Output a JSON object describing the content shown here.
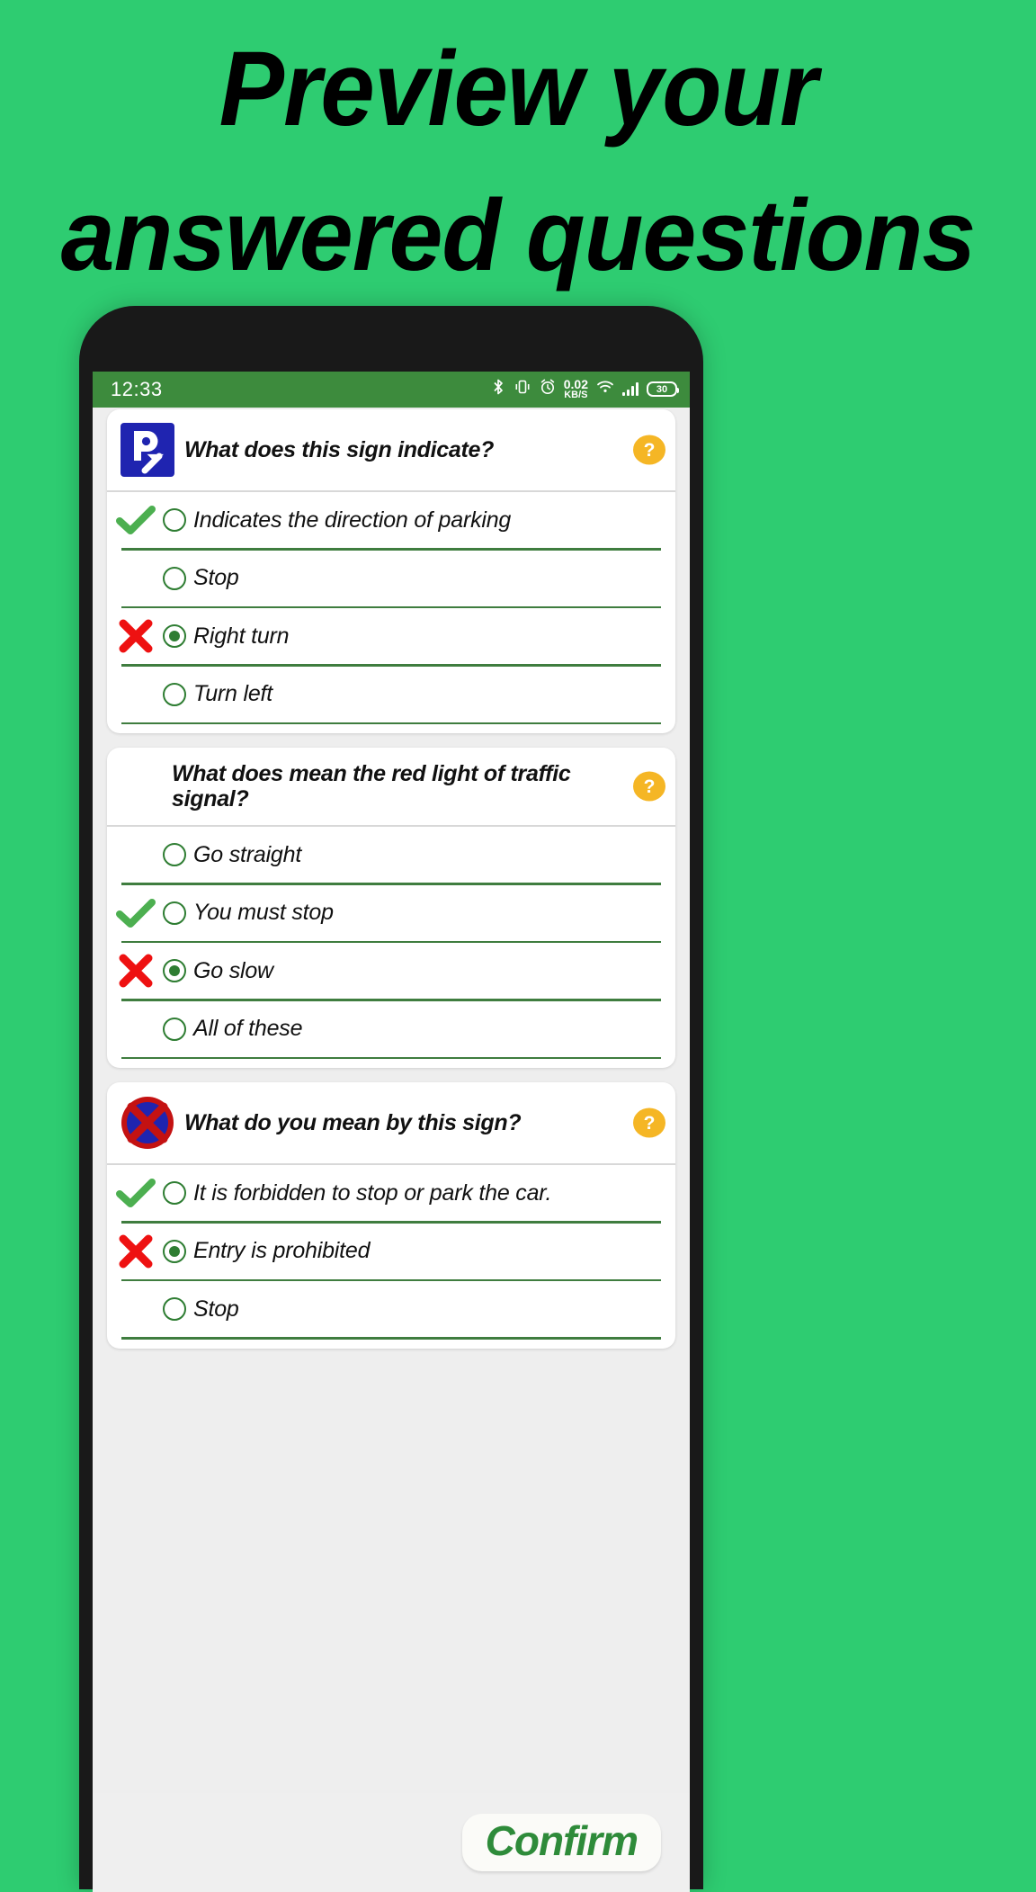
{
  "promo": {
    "headline_line1": "Preview your",
    "headline_line2": "answered questions",
    "background_color": "#2ECC71"
  },
  "statusbar": {
    "time": "12:33",
    "background_color": "#3d8b3d",
    "net_speed_value": "0.02",
    "net_speed_unit": "KB/S",
    "battery_level": "30",
    "icons": [
      "bluetooth-icon",
      "vibrate-icon",
      "alarm-icon",
      "net-speed-icon",
      "wifi-icon",
      "signal-icon",
      "battery-icon"
    ]
  },
  "theme": {
    "accent_green": "#2e7d32",
    "divider_green": "#3f7d3f",
    "correct_green": "#4CAF50",
    "wrong_red": "#ee1111",
    "help_yellow": "#f5b625",
    "screen_bg": "#eeeeee"
  },
  "questions": [
    {
      "text": "What does this sign indicate?",
      "sign": "parking-direction-sign",
      "help_label": "?",
      "options": [
        {
          "label": "Indicates the direction of parking",
          "selected": false,
          "mark": "correct"
        },
        {
          "label": "Stop",
          "selected": false,
          "mark": "none"
        },
        {
          "label": "Right turn",
          "selected": true,
          "mark": "wrong"
        },
        {
          "label": "Turn left",
          "selected": false,
          "mark": "none"
        }
      ]
    },
    {
      "text": "What does mean the red light of traffic signal?",
      "sign": "none",
      "help_label": "?",
      "options": [
        {
          "label": "Go straight",
          "selected": false,
          "mark": "none"
        },
        {
          "label": "You must stop",
          "selected": false,
          "mark": "correct"
        },
        {
          "label": "Go slow",
          "selected": true,
          "mark": "wrong"
        },
        {
          "label": "All of these",
          "selected": false,
          "mark": "none"
        }
      ]
    },
    {
      "text": "What do you mean by this sign?",
      "sign": "no-stopping-sign",
      "help_label": "?",
      "options": [
        {
          "label": "It is forbidden to stop or park the car.",
          "selected": false,
          "mark": "correct"
        },
        {
          "label": "Entry is prohibited",
          "selected": true,
          "mark": "wrong"
        },
        {
          "label": "Stop",
          "selected": false,
          "mark": "none"
        }
      ]
    }
  ],
  "bottom": {
    "confirm_label": "Confirm"
  }
}
